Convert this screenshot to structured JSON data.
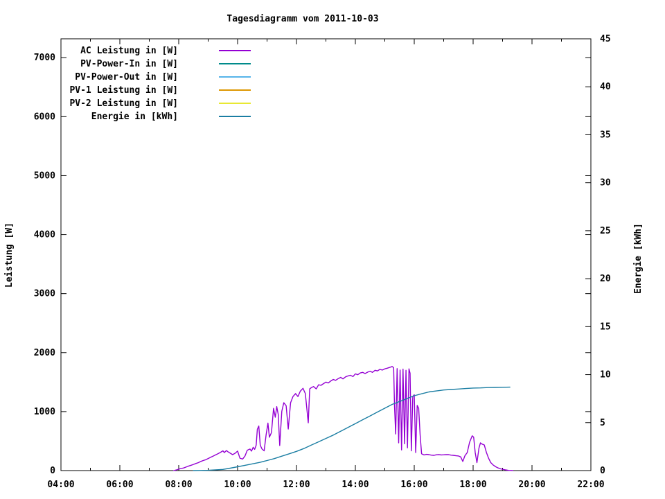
{
  "chart_data": {
    "type": "line",
    "title": "Tagesdiagramm vom 2011-10-03",
    "grid": false,
    "legend_position": "top-left-inside",
    "x_axis": {
      "range_hours": [
        4,
        22
      ],
      "tick_hours": [
        4,
        6,
        8,
        10,
        12,
        14,
        16,
        18,
        20,
        22
      ],
      "tick_labels": [
        "04:00",
        "06:00",
        "08:00",
        "10:00",
        "12:00",
        "14:00",
        "16:00",
        "18:00",
        "20:00",
        "22:00"
      ],
      "minor_tick_step_hours": 1
    },
    "y_left_axis": {
      "label": "Leistung [W]",
      "range": [
        0,
        7320
      ],
      "tick_values": [
        0,
        1000,
        2000,
        3000,
        4000,
        5000,
        6000,
        7000
      ],
      "tick_labels": [
        "0",
        "1000",
        "2000",
        "3000",
        "4000",
        "5000",
        "6000",
        "7000"
      ]
    },
    "y_right_axis": {
      "label": "Energie [kWh]",
      "range": [
        0,
        45
      ],
      "tick_values": [
        0,
        5,
        10,
        15,
        20,
        25,
        30,
        35,
        40,
        45
      ],
      "tick_labels": [
        "0",
        "5",
        "10",
        "15",
        "20",
        "25",
        "30",
        "35",
        "40",
        "45"
      ]
    },
    "series": [
      {
        "name": "AC Leistung in [W]",
        "color": "#9400D3",
        "axis": "left",
        "points": [
          [
            7.83,
            0
          ],
          [
            7.92,
            10
          ],
          [
            8.0,
            25
          ],
          [
            8.08,
            35
          ],
          [
            8.17,
            45
          ],
          [
            8.25,
            60
          ],
          [
            8.33,
            75
          ],
          [
            8.42,
            90
          ],
          [
            8.5,
            105
          ],
          [
            8.58,
            120
          ],
          [
            8.67,
            135
          ],
          [
            8.75,
            155
          ],
          [
            8.83,
            170
          ],
          [
            8.92,
            185
          ],
          [
            9.0,
            205
          ],
          [
            9.08,
            225
          ],
          [
            9.17,
            245
          ],
          [
            9.25,
            265
          ],
          [
            9.33,
            285
          ],
          [
            9.42,
            310
          ],
          [
            9.5,
            335
          ],
          [
            9.55,
            305
          ],
          [
            9.62,
            340
          ],
          [
            9.67,
            320
          ],
          [
            9.75,
            295
          ],
          [
            9.83,
            270
          ],
          [
            9.92,
            295
          ],
          [
            10.0,
            330
          ],
          [
            10.05,
            255
          ],
          [
            10.08,
            210
          ],
          [
            10.17,
            195
          ],
          [
            10.25,
            245
          ],
          [
            10.33,
            345
          ],
          [
            10.42,
            365
          ],
          [
            10.47,
            330
          ],
          [
            10.53,
            395
          ],
          [
            10.58,
            360
          ],
          [
            10.63,
            430
          ],
          [
            10.67,
            700
          ],
          [
            10.72,
            755
          ],
          [
            10.77,
            430
          ],
          [
            10.83,
            365
          ],
          [
            10.9,
            335
          ],
          [
            10.97,
            610
          ],
          [
            11.03,
            805
          ],
          [
            11.08,
            565
          ],
          [
            11.15,
            645
          ],
          [
            11.22,
            1055
          ],
          [
            11.28,
            905
          ],
          [
            11.33,
            1085
          ],
          [
            11.38,
            950
          ],
          [
            11.43,
            425
          ],
          [
            11.5,
            1005
          ],
          [
            11.57,
            1150
          ],
          [
            11.65,
            1100
          ],
          [
            11.72,
            705
          ],
          [
            11.8,
            1150
          ],
          [
            11.88,
            1255
          ],
          [
            11.97,
            1305
          ],
          [
            12.05,
            1255
          ],
          [
            12.13,
            1345
          ],
          [
            12.22,
            1395
          ],
          [
            12.3,
            1305
          ],
          [
            12.4,
            810
          ],
          [
            12.45,
            1385
          ],
          [
            12.5,
            1405
          ],
          [
            12.58,
            1425
          ],
          [
            12.67,
            1385
          ],
          [
            12.75,
            1455
          ],
          [
            12.83,
            1445
          ],
          [
            12.92,
            1475
          ],
          [
            13.0,
            1500
          ],
          [
            13.08,
            1485
          ],
          [
            13.17,
            1520
          ],
          [
            13.25,
            1545
          ],
          [
            13.33,
            1530
          ],
          [
            13.42,
            1560
          ],
          [
            13.5,
            1580
          ],
          [
            13.58,
            1555
          ],
          [
            13.67,
            1590
          ],
          [
            13.75,
            1605
          ],
          [
            13.83,
            1615
          ],
          [
            13.92,
            1595
          ],
          [
            14.0,
            1640
          ],
          [
            14.08,
            1625
          ],
          [
            14.17,
            1655
          ],
          [
            14.25,
            1665
          ],
          [
            14.33,
            1645
          ],
          [
            14.42,
            1670
          ],
          [
            14.5,
            1685
          ],
          [
            14.58,
            1665
          ],
          [
            14.67,
            1700
          ],
          [
            14.75,
            1690
          ],
          [
            14.83,
            1715
          ],
          [
            14.92,
            1705
          ],
          [
            15.0,
            1725
          ],
          [
            15.08,
            1735
          ],
          [
            15.17,
            1750
          ],
          [
            15.25,
            1765
          ],
          [
            15.3,
            1745
          ],
          [
            15.33,
            1100
          ],
          [
            15.37,
            620
          ],
          [
            15.42,
            1730
          ],
          [
            15.47,
            470
          ],
          [
            15.52,
            1705
          ],
          [
            15.57,
            350
          ],
          [
            15.62,
            1720
          ],
          [
            15.67,
            455
          ],
          [
            15.72,
            1700
          ],
          [
            15.77,
            385
          ],
          [
            15.82,
            1725
          ],
          [
            15.86,
            1650
          ],
          [
            15.9,
            335
          ],
          [
            15.95,
            1255
          ],
          [
            16.0,
            1285
          ],
          [
            16.05,
            305
          ],
          [
            16.1,
            1105
          ],
          [
            16.15,
            1055
          ],
          [
            16.2,
            605
          ],
          [
            16.25,
            285
          ],
          [
            16.33,
            265
          ],
          [
            16.42,
            275
          ],
          [
            16.5,
            270
          ],
          [
            16.58,
            262
          ],
          [
            16.67,
            258
          ],
          [
            16.75,
            268
          ],
          [
            16.83,
            272
          ],
          [
            16.92,
            266
          ],
          [
            17.0,
            268
          ],
          [
            17.08,
            272
          ],
          [
            17.17,
            270
          ],
          [
            17.25,
            262
          ],
          [
            17.33,
            258
          ],
          [
            17.42,
            252
          ],
          [
            17.5,
            248
          ],
          [
            17.58,
            232
          ],
          [
            17.65,
            155
          ],
          [
            17.72,
            250
          ],
          [
            17.8,
            305
          ],
          [
            17.88,
            480
          ],
          [
            17.97,
            590
          ],
          [
            18.02,
            565
          ],
          [
            18.07,
            305
          ],
          [
            18.13,
            135
          ],
          [
            18.2,
            385
          ],
          [
            18.25,
            470
          ],
          [
            18.3,
            450
          ],
          [
            18.38,
            435
          ],
          [
            18.45,
            310
          ],
          [
            18.53,
            205
          ],
          [
            18.6,
            135
          ],
          [
            18.68,
            95
          ],
          [
            18.77,
            65
          ],
          [
            18.85,
            45
          ],
          [
            18.93,
            30
          ],
          [
            19.0,
            22
          ],
          [
            19.1,
            12
          ],
          [
            19.2,
            4
          ],
          [
            19.35,
            0
          ]
        ]
      },
      {
        "name": "PV-Power-In in [W]",
        "color": "#008B8B",
        "axis": "left",
        "points": [],
        "note": "no visible curve in plot area"
      },
      {
        "name": "PV-Power-Out in [W]",
        "color": "#56B4E9",
        "axis": "left",
        "points": [],
        "note": "no visible curve in plot area"
      },
      {
        "name": "PV-1 Leistung in [W]",
        "color": "#DD9700",
        "axis": "left",
        "points": [],
        "note": "no visible curve in plot area"
      },
      {
        "name": "PV-2 Leistung in [W]",
        "color": "#E8E833",
        "axis": "left",
        "points": [],
        "note": "no visible curve in plot area"
      },
      {
        "name": "Energie in [kWh]",
        "color": "#1B7EA3",
        "axis": "right",
        "points": [
          [
            8.5,
            0
          ],
          [
            9.0,
            0.03
          ],
          [
            9.5,
            0.12
          ],
          [
            9.75,
            0.25
          ],
          [
            10.0,
            0.4
          ],
          [
            10.25,
            0.55
          ],
          [
            10.5,
            0.7
          ],
          [
            10.75,
            0.85
          ],
          [
            11.0,
            1.05
          ],
          [
            11.25,
            1.25
          ],
          [
            11.5,
            1.5
          ],
          [
            11.75,
            1.75
          ],
          [
            12.0,
            2.0
          ],
          [
            12.25,
            2.3
          ],
          [
            12.5,
            2.65
          ],
          [
            12.75,
            3.0
          ],
          [
            13.0,
            3.35
          ],
          [
            13.25,
            3.7
          ],
          [
            13.5,
            4.1
          ],
          [
            13.75,
            4.5
          ],
          [
            14.0,
            4.9
          ],
          [
            14.25,
            5.3
          ],
          [
            14.5,
            5.7
          ],
          [
            14.75,
            6.1
          ],
          [
            15.0,
            6.5
          ],
          [
            15.25,
            6.9
          ],
          [
            15.5,
            7.2
          ],
          [
            15.75,
            7.5
          ],
          [
            16.0,
            7.8
          ],
          [
            16.25,
            8.0
          ],
          [
            16.5,
            8.2
          ],
          [
            16.75,
            8.3
          ],
          [
            17.0,
            8.4
          ],
          [
            17.25,
            8.45
          ],
          [
            17.5,
            8.5
          ],
          [
            17.75,
            8.55
          ],
          [
            18.0,
            8.6
          ],
          [
            18.25,
            8.62
          ],
          [
            18.5,
            8.65
          ],
          [
            18.75,
            8.67
          ],
          [
            19.0,
            8.68
          ],
          [
            19.25,
            8.7
          ]
        ]
      }
    ]
  }
}
